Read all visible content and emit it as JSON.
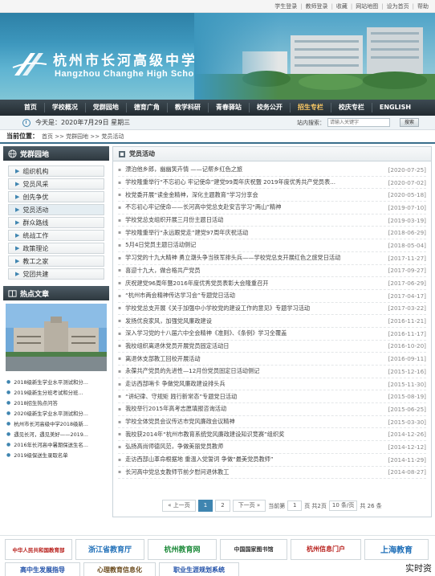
{
  "topbar": {
    "links": [
      "学生登录",
      "教师登录",
      "收藏",
      "网站地图",
      "设为首页",
      "帮助"
    ]
  },
  "banner": {
    "title_cn": "杭州市长河高级中学",
    "title_en": "Hangzhou Changhe High School"
  },
  "nav": {
    "items": [
      "首页",
      "学校概况",
      "党群园地",
      "德育广角",
      "教学科研",
      "青春驿站",
      "校务公开",
      "招生专栏",
      "校庆专栏",
      "ENGLISH"
    ]
  },
  "datebar": {
    "date_text": "今天是：2020年7月29日 星期三",
    "search_label": "站内搜索：",
    "search_placeholder": "请输入关键字",
    "search_button": "搜索"
  },
  "breadcrumb": {
    "label": "当前位置：",
    "path": "首页 >> 党群园地 >> 党员活动"
  },
  "sidebar": {
    "title": "党群园地",
    "items": [
      "组织机构",
      "党员风采",
      "创先争优",
      "党员活动",
      "群众路线",
      "统战工作",
      "政策理论",
      "教工之家",
      "党团共建"
    ],
    "active_index": 3
  },
  "hot": {
    "title": "热点文章",
    "items": [
      "2018级新生学业水平测试和分...",
      "2019级新生分班考试和分班...",
      "2018招生热点问答",
      "2020级新生学业水平测试和分...",
      "杭州市长河高级中学2018级新...",
      "遇见长河，遇见美好——2019...",
      "2016年长河高中暑期保送生名...",
      "2019级保送生录取名单"
    ]
  },
  "main": {
    "title": "党员活动",
    "articles": [
      {
        "title": "漂泊他乡郎，幽幽笑卉情 ——记帮乡红色之旅",
        "date": "[2020-07-25]"
      },
      {
        "title": "学校隆重举行“不忘初心 牢记使命”建党99周年庆祝暨 2019年度优秀共产党员表...",
        "date": "[2020-07-02]"
      },
      {
        "title": "校党委开展“读金金精神，深化主题教育”学习分享会",
        "date": "[2020-05-18]"
      },
      {
        "title": "不忘初心牢记使命——长河高中党总支赴安吉学习“两山”精神",
        "date": "[2019-07-10]"
      },
      {
        "title": "学校党总支组织开展三月份主题日活动",
        "date": "[2019-03-19]"
      },
      {
        "title": "学校隆重举行“永远跟党走”建党97周年庆祝活动",
        "date": "[2018-06-29]"
      },
      {
        "title": "5月4日党员主题日活动侧记",
        "date": "[2018-05-04]"
      },
      {
        "title": "学习党的十九大精神 勇立潮头争当铁军排头兵——学校党总支开展红色之旅党日活动",
        "date": "[2017-11-27]"
      },
      {
        "title": "喜迎十九大，做合格共产党员",
        "date": "[2017-09-27]"
      },
      {
        "title": "庆祝建党96周年暨2016年度优秀党员表彰大会隆重召开",
        "date": "[2017-06-29]"
      },
      {
        "title": "“杭州市两会精神传达学习会”专题党日活动",
        "date": "[2017-04-17]"
      },
      {
        "title": "学校党总支开展《关于加强中小学校党的建设工作的意见》专题学习活动",
        "date": "[2017-03-22]"
      },
      {
        "title": "发扬优良家风，加强党风廉政建设",
        "date": "[2016-11-21]"
      },
      {
        "title": "深入学习党的十八届六中全会精神《准则》、《条例》学习全覆盖",
        "date": "[2016-11-17]"
      },
      {
        "title": "我校组织离退休党员开展党员固定活动日",
        "date": "[2016-10-20]"
      },
      {
        "title": "离退休支部教工回校开展活动",
        "date": "[2016-09-11]"
      },
      {
        "title": "永葆共产党员的先进性—12月份党员固定日活动侧记",
        "date": "[2015-12-16]"
      },
      {
        "title": "走访西部哨卡 争做党风廉政建设排头兵",
        "date": "[2015-11-30]"
      },
      {
        "title": "“讲纪律、守规矩 践行新常态”专题党日活动",
        "date": "[2015-08-19]"
      },
      {
        "title": "我校举行2015年高考志愿填报咨询活动",
        "date": "[2015-06-25]"
      },
      {
        "title": "学校全体党员会议传达市党风廉政会议精神",
        "date": "[2015-03-30]"
      },
      {
        "title": "我校获2014年“杭州市教育系统党风廉政建设知识竞赛”组织奖",
        "date": "[2014-12-26]"
      },
      {
        "title": "弘扬高尚师德风范，争做美丽党员教师",
        "date": "[2014-12-12]"
      },
      {
        "title": "走访西部山革命根据地 重温入党誓词 争做“最美党员教师”",
        "date": "[2014-11-29]"
      },
      {
        "title": "长河高中党总支教师节前夕慰问退休教工",
        "date": "[2014-08-27]"
      }
    ]
  },
  "pager": {
    "prev": "« 上一页",
    "pages": [
      "1",
      "2"
    ],
    "current": "1",
    "next": "下一页 »",
    "goto_label": "当前第",
    "goto_value": "1",
    "total_pages": "页 共2页",
    "per_page": "10 条/页",
    "total_items": "共 26 条"
  },
  "footer_links": [
    {
      "label": "中华人民共和国教育部",
      "color": "#b8201c"
    },
    {
      "label": "浙江省教育厅",
      "color": "#1f6fb8"
    },
    {
      "label": "杭州教育网",
      "color": "#1d8a3a"
    },
    {
      "label": "中国国家图书馆",
      "color": "#333333"
    },
    {
      "label": "杭州信息门户",
      "color": "#b8201c"
    },
    {
      "label": "上海教育",
      "color": "#1f6fb8"
    }
  ],
  "footer_links2": [
    {
      "label": "高中生发展指导",
      "color": "#1f4fa8"
    },
    {
      "label": "心理教育信息化",
      "color": "#6a4a1c"
    },
    {
      "label": "职业生涯规划系统",
      "color": "#1f4fa8"
    }
  ],
  "corner_text": "实时资"
}
